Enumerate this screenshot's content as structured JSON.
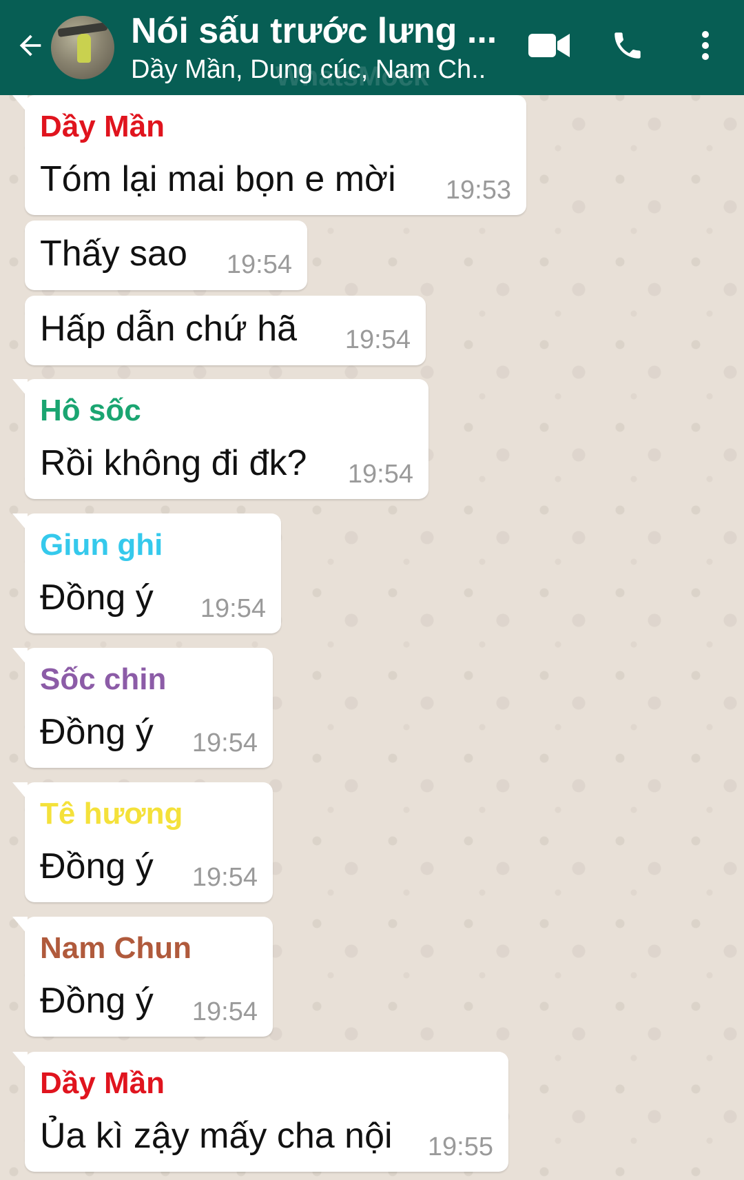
{
  "header": {
    "title": "Nói sấu trước lưng ...",
    "subtitle": "Dầy Mần, Dung cúc, Nam Ch..",
    "watermark": "WhatsMock",
    "icons": {
      "back": "arrow-left-icon",
      "video": "video-camera-icon",
      "call": "phone-icon",
      "menu": "more-vertical-icon"
    },
    "color": "#075e54"
  },
  "messages": [
    {
      "sender": "Dầy Mần",
      "sender_color": "#e0141e",
      "text": "Tóm lại mai bọn e mời",
      "time": "19:53"
    },
    {
      "sender": "",
      "sender_color": "",
      "text": "Thấy sao",
      "time": "19:54"
    },
    {
      "sender": "",
      "sender_color": "",
      "text": "Hấp dẫn chứ hã",
      "time": "19:54"
    },
    {
      "sender": "Hô sốc",
      "sender_color": "#1aa571",
      "text": "Rồi không đi đk?",
      "time": "19:54"
    },
    {
      "sender": "Giun ghi",
      "sender_color": "#35c9ec",
      "text": "Đồng ý",
      "time": "19:54"
    },
    {
      "sender": "Sốc chin",
      "sender_color": "#8c5ca7",
      "text": "Đồng ý",
      "time": "19:54"
    },
    {
      "sender": "Tê hương",
      "sender_color": "#f4e13a",
      "text": "Đồng ý",
      "time": "19:54"
    },
    {
      "sender": "Nam Chun",
      "sender_color": "#b05a3c",
      "text": "Đồng ý",
      "time": "19:54"
    },
    {
      "sender": "Dầy Mần",
      "sender_color": "#e0141e",
      "text": "Ủa kì zậy mấy cha nội",
      "time": "19:55"
    }
  ]
}
